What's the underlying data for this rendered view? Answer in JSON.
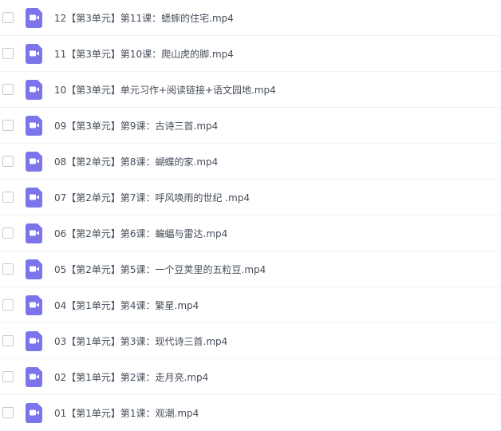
{
  "file_list": {
    "icon": "video-file-icon",
    "icon_color": "#7b74ea",
    "items": [
      {
        "name": "12【第3单元】第11课：蟋蟀的住宅.mp4"
      },
      {
        "name": "11【第3单元】第10课：爬山虎的脚.mp4"
      },
      {
        "name": "10【第3单元】单元习作+阅读链接+语文园地.mp4"
      },
      {
        "name": "09【第3单元】第9课：古诗三首.mp4"
      },
      {
        "name": "08【第2单元】第8课：蝴蝶的家.mp4"
      },
      {
        "name": "07【第2单元】第7课：呼风唤雨的世纪 .mp4"
      },
      {
        "name": "06【第2单元】第6课：蝙蝠与雷达.mp4"
      },
      {
        "name": "05【第2单元】第5课：一个豆荚里的五粒豆.mp4"
      },
      {
        "name": "04【第1单元】第4课：繁星.mp4"
      },
      {
        "name": "03【第1单元】第3课：现代诗三首.mp4"
      },
      {
        "name": "02【第1单元】第2课：走月亮.mp4"
      },
      {
        "name": "01【第1单元】第1课：观潮.mp4"
      }
    ]
  }
}
